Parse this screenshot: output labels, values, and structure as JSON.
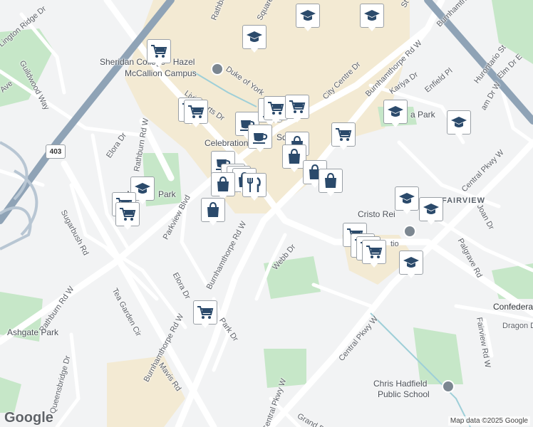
{
  "map": {
    "attribution": "Map data ©2025 Google",
    "logo": "Google",
    "highway_shield": "403",
    "colors": {
      "pin_icon": "#2b4a6b",
      "park": "#c6e7c8",
      "highway": "#8fa3b6",
      "commercial": "#f3ead3"
    },
    "street_labels": {
      "rathburn_top": "Rathburn",
      "square_one": "Square One",
      "burnhamthorpe_ne": "Burnhamthorpe Rd W",
      "hurontario": "Hurontario St",
      "city_centre": "City Centre Dr",
      "duke_of_york": "Duke of York",
      "living_arts": "Living Arts Dr",
      "kariya": "Kariya Dr",
      "enfield": "Enfield Pl",
      "elm": "Elm Dr E",
      "lgn_ridge": "Lington Ridge Dr",
      "guildwood": "Guildwood Way",
      "ave": "Ave",
      "rathburn_w": "Rathburn Rd W",
      "elora_top": "Elora Dr",
      "sugarbush": "Sugarbush Rd",
      "parkview": "Parkview Blvd",
      "elora_mid": "Elora Dr",
      "burnhamthorpe_mid": "Burnhamthorpe Rd W",
      "burnhamthorpe_sw": "Burnhamthorpe Rd W",
      "webb": "Webb Dr",
      "tea_garden": "Tea Garden Cir",
      "rathburn_sw": "Rathburn Rd W",
      "mavis": "Mavis Rd",
      "queensbridge": "Queensbridge Dr",
      "park_dr": "Park Dr",
      "central_pkwy_e": "Central Pkwy W",
      "central_pkwy_s": "Central Pkwy W",
      "central_pkwy_bot": "Central Pkwy W",
      "joan": "Joan Dr",
      "palgrave": "Palgrave Rd",
      "confederation": "Confedera",
      "dragon": "Dragon Dr",
      "fairview_rd": "Fairview Rd W",
      "grand_park": "Grand Pa",
      "burnhamthorpe_top": "Burnhamthorpe Way",
      "dam_dr": "am Dr W",
      "tio": "tio",
      "top_st": "St"
    },
    "poi_labels": {
      "sheridan": "Sheridan College - Hazel",
      "sheridan2": "McCallion Campus",
      "celebration": "Celebration",
      "square": "Sq",
      "kariya_park": "a Park",
      "fairview": "FAIRVIEW",
      "cristo": "Cristo Rei",
      "ashgate": "Ashgate Park",
      "chris": "Chris Hadfield",
      "chris2": "Public School",
      "m_park": "M",
      "park": "Park"
    }
  }
}
